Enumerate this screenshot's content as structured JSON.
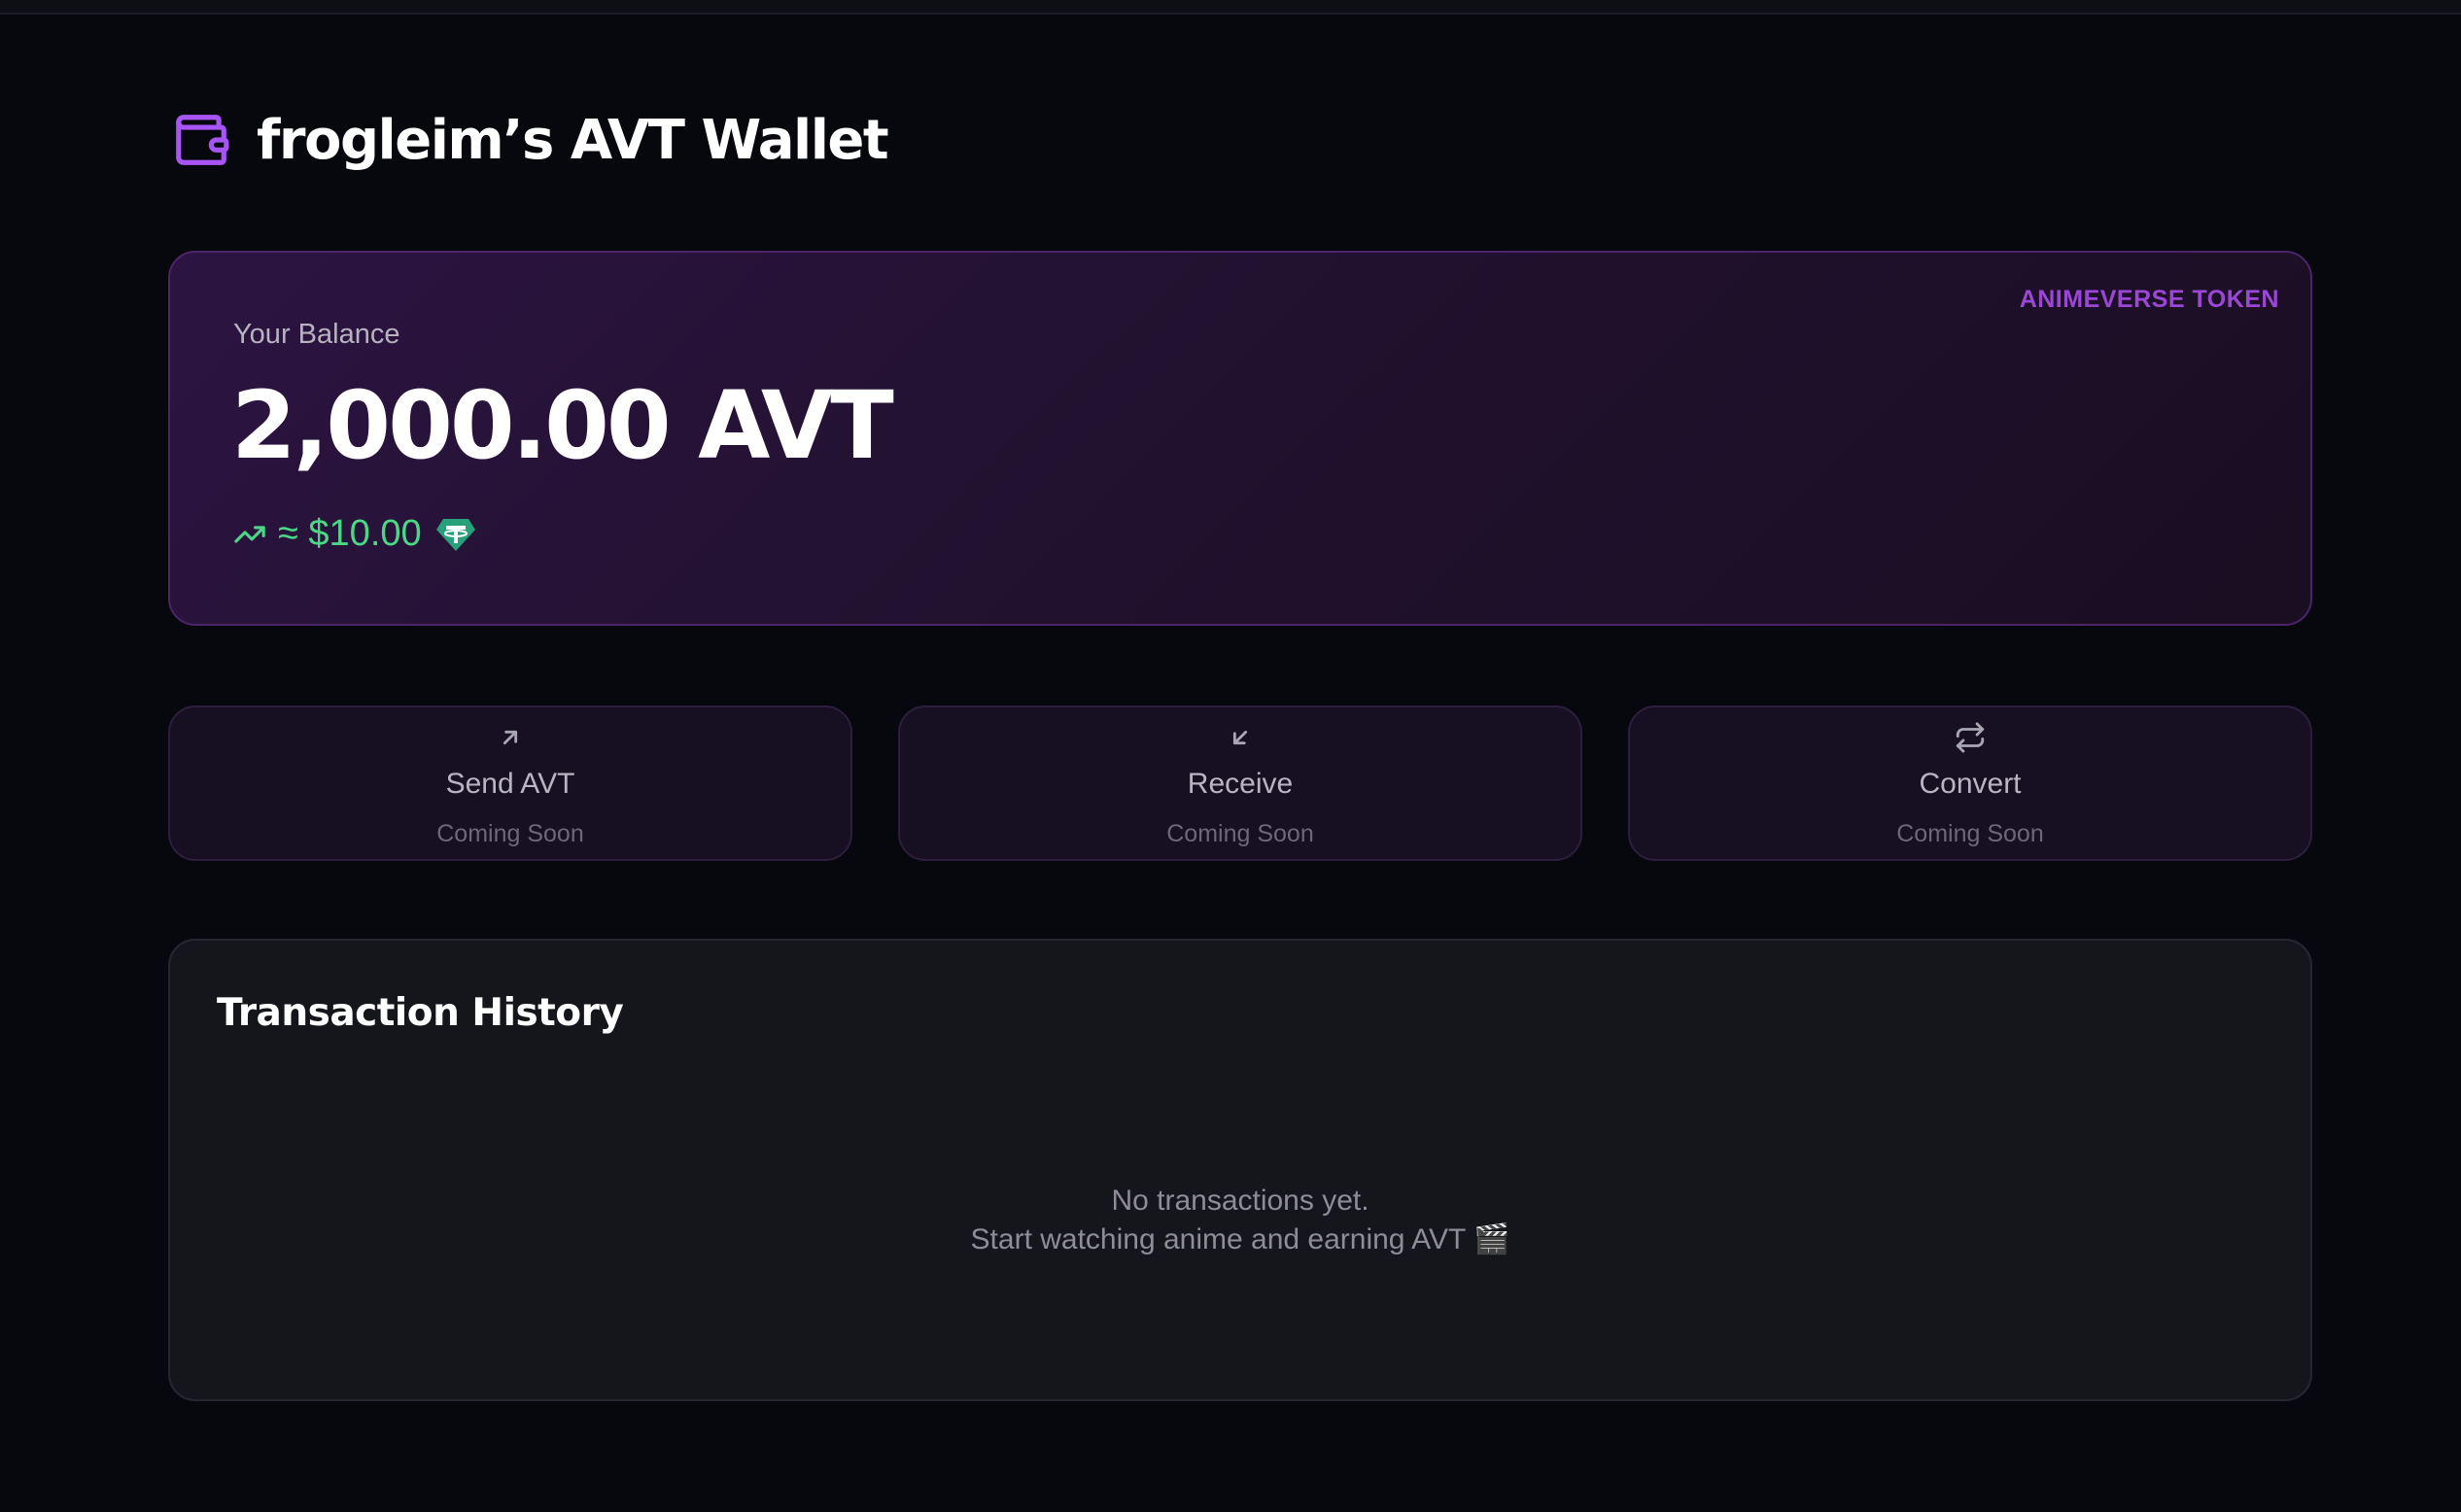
{
  "header": {
    "icon": "wallet-icon",
    "title": "frogleim’s AVT Wallet",
    "accent_color": "#a855f7"
  },
  "balance": {
    "label": "Your Balance",
    "token_tag": "ANIMEVERSE TOKEN",
    "amount": "2,000.00 AVT",
    "usd_value": "≈ $10.00",
    "trend_icon": "trending-up-icon",
    "currency_icon": "tether-icon",
    "positive_color": "#4cd787"
  },
  "actions": [
    {
      "icon": "arrow-up-right-icon",
      "label": "Send AVT",
      "status": "Coming Soon"
    },
    {
      "icon": "arrow-down-left-icon",
      "label": "Receive",
      "status": "Coming Soon"
    },
    {
      "icon": "repeat-icon",
      "label": "Convert",
      "status": "Coming Soon"
    }
  ],
  "history": {
    "title": "Transaction History",
    "empty_line_1": "No transactions yet.",
    "empty_line_2": "Start watching anime and earning AVT 🎬"
  }
}
